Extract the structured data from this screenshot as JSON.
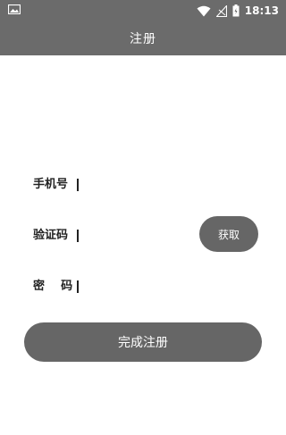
{
  "status_bar": {
    "time": "18:13",
    "icons": [
      "image-icon",
      "wifi-icon",
      "signal-icon",
      "battery-icon"
    ],
    "background": "#6b6b6b"
  },
  "app_bar": {
    "title": "注册"
  },
  "form": {
    "phone": {
      "label": "手机号",
      "value": ""
    },
    "code": {
      "label": "验证码",
      "value": ""
    },
    "password": {
      "label": "密    码",
      "value": ""
    }
  },
  "buttons": {
    "get_code": "获取",
    "submit": "完成注册",
    "color": "#666666"
  }
}
